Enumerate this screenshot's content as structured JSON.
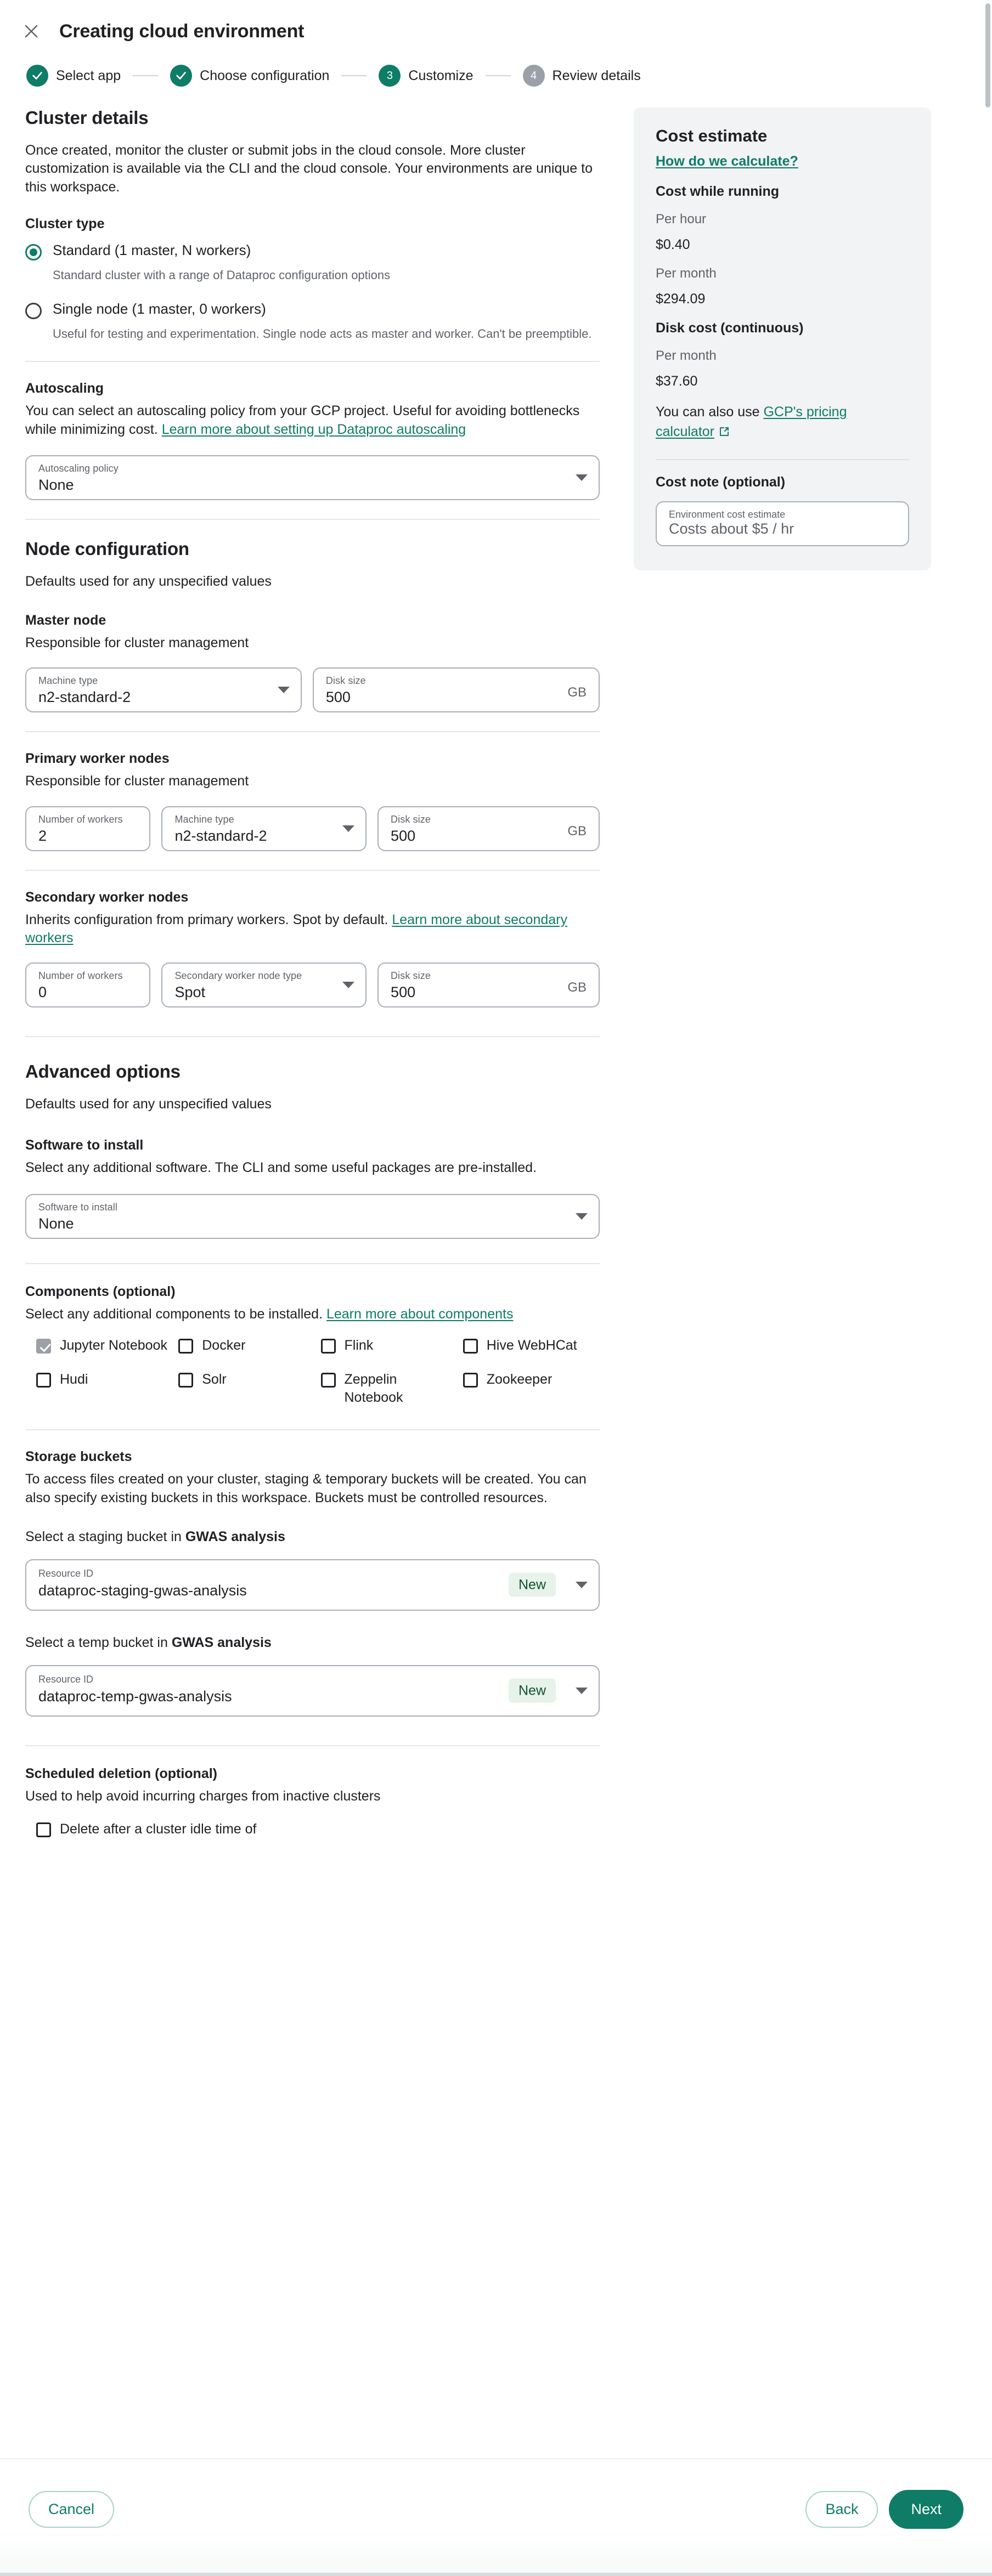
{
  "window": {
    "title": "Creating cloud environment",
    "close_icon": "close-icon"
  },
  "stepper": {
    "steps": [
      {
        "label": "Select app",
        "state": "done",
        "marker": "check"
      },
      {
        "label": "Choose configuration",
        "state": "done",
        "marker": "check"
      },
      {
        "label": "Customize",
        "state": "active",
        "marker": "3"
      },
      {
        "label": "Review details",
        "state": "todo",
        "marker": "4"
      }
    ]
  },
  "cluster_details": {
    "title": "Cluster details",
    "description": "Once created, monitor the cluster or submit jobs in the cloud console. More cluster customization is available via the CLI and the cloud console. Your environments are unique to this workspace.",
    "cluster_type_label": "Cluster type",
    "options": [
      {
        "label": "Standard (1 master, N workers)",
        "description": "Standard cluster with a range of Dataproc configuration options",
        "selected": true
      },
      {
        "label": "Single node (1 master, 0 workers)",
        "description": "Useful for testing and experimentation. Single node acts as master and worker. Can't be preemptible.",
        "selected": false
      }
    ]
  },
  "autoscaling": {
    "title": "Autoscaling",
    "description_before": "You can select an autoscaling policy from your GCP project. Useful for avoiding bottlenecks while minimizing cost. ",
    "link_text": "Learn more about setting up Dataproc autoscaling",
    "field": {
      "label": "Autoscaling policy",
      "value": "None"
    }
  },
  "node_configuration": {
    "title": "Node configuration",
    "subtitle": "Defaults used for any unspecified values",
    "master": {
      "title": "Master node",
      "description": "Responsible for cluster management",
      "machine_type": {
        "label": "Machine type",
        "value": "n2-standard-2"
      },
      "disk_size": {
        "label": "Disk size",
        "value": "500",
        "unit": "GB"
      }
    },
    "primary_workers": {
      "title": "Primary worker nodes",
      "description": "Responsible for cluster management",
      "number_of_workers": {
        "label": "Number of workers",
        "value": "2"
      },
      "machine_type": {
        "label": "Machine type",
        "value": "n2-standard-2"
      },
      "disk_size": {
        "label": "Disk size",
        "value": "500",
        "unit": "GB"
      }
    },
    "secondary_workers": {
      "title": "Secondary worker nodes",
      "description_before": "Inherits configuration from primary workers. Spot by default. ",
      "link_text": "Learn more about secondary workers",
      "number_of_workers": {
        "label": "Number of workers",
        "value": "0"
      },
      "node_type": {
        "label": "Secondary worker node type",
        "value": "Spot"
      },
      "disk_size": {
        "label": "Disk size",
        "value": "500",
        "unit": "GB"
      }
    }
  },
  "advanced_options": {
    "title": "Advanced options",
    "subtitle": "Defaults used for any unspecified values",
    "software": {
      "title": "Software to install",
      "description": "Select any additional software. The CLI and some useful packages are pre-installed.",
      "field": {
        "label": "Software to install",
        "value": "None"
      }
    },
    "components": {
      "title": "Components (optional)",
      "description_before": "Select any additional components to be installed. ",
      "link_text": "Learn more about components",
      "items": [
        {
          "label": "Jupyter Notebook",
          "checked": true,
          "disabled": true
        },
        {
          "label": "Docker",
          "checked": false,
          "disabled": false
        },
        {
          "label": "Flink",
          "checked": false,
          "disabled": false
        },
        {
          "label": "Hive WebHCat",
          "checked": false,
          "disabled": false
        },
        {
          "label": "Hudi",
          "checked": false,
          "disabled": false
        },
        {
          "label": "Solr",
          "checked": false,
          "disabled": false
        },
        {
          "label": "Zeppelin Notebook",
          "checked": false,
          "disabled": false
        },
        {
          "label": "Zookeeper",
          "checked": false,
          "disabled": false
        }
      ]
    },
    "storage": {
      "title": "Storage buckets",
      "description": "To access files created on your cluster, staging & temporary buckets will be created. You can also specify existing buckets in this workspace. Buckets must be controlled resources.",
      "staging": {
        "prompt_prefix": "Select a staging bucket in ",
        "prompt_workspace": "GWAS analysis",
        "label": "Resource ID",
        "value": "dataproc-staging-gwas-analysis",
        "badge": "New"
      },
      "temp": {
        "prompt_prefix": "Select a temp bucket in ",
        "prompt_workspace": "GWAS analysis",
        "label": "Resource ID",
        "value": "dataproc-temp-gwas-analysis",
        "badge": "New"
      }
    },
    "scheduled_deletion": {
      "title": "Scheduled deletion (optional)",
      "description": "Used to help avoid incurring charges from inactive clusters",
      "checkbox_label": "Delete after a cluster idle time of",
      "checked": false
    }
  },
  "cost_estimate": {
    "title": "Cost estimate",
    "how_link": "How do we calculate?",
    "running_title": "Cost while running",
    "per_hour_label": "Per hour",
    "per_hour_value": "$0.40",
    "per_month_label": "Per month",
    "per_month_value": "$294.09",
    "disk_title": "Disk cost (continuous)",
    "disk_per_month_label": "Per month",
    "disk_per_month_value": "$37.60",
    "calculator_prefix": "You can also use ",
    "calculator_link": "GCP's pricing calculator",
    "note_title": "Cost note (optional)",
    "note_field_label": "Environment cost estimate",
    "note_field_placeholder": "Costs about $5 / hr"
  },
  "footer": {
    "cancel": "Cancel",
    "back": "Back",
    "next": "Next"
  },
  "colors": {
    "accent": "#0E7C66",
    "muted": "#5f6368",
    "card_bg": "#f1f3f4",
    "badge_bg": "#e6f2ea",
    "badge_text": "#14532d"
  }
}
